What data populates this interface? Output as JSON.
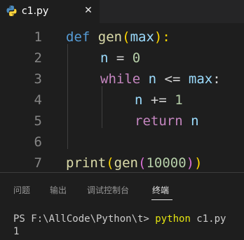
{
  "editor_tab": {
    "filename": "c1.py",
    "close_glyph": "✕",
    "icon": "python-icon"
  },
  "code_lines": [
    {
      "number": "1",
      "tokens": [
        {
          "text": "def",
          "kind": "keyword"
        },
        {
          "text": " ",
          "kind": "plain"
        },
        {
          "text": "gen",
          "kind": "function"
        },
        {
          "text": "(",
          "kind": "paren"
        },
        {
          "text": "max",
          "kind": "variable"
        },
        {
          "text": "):",
          "kind": "paren"
        }
      ]
    },
    {
      "number": "2",
      "tokens": [
        {
          "text": "n",
          "kind": "variable"
        },
        {
          "text": " = ",
          "kind": "plain"
        },
        {
          "text": "0",
          "kind": "number"
        }
      ]
    },
    {
      "number": "3",
      "tokens": [
        {
          "text": "while",
          "kind": "control"
        },
        {
          "text": " ",
          "kind": "plain"
        },
        {
          "text": "n",
          "kind": "variable"
        },
        {
          "text": " <= ",
          "kind": "plain"
        },
        {
          "text": "max",
          "kind": "variable"
        },
        {
          "text": ":",
          "kind": "plain"
        }
      ]
    },
    {
      "number": "4",
      "tokens": [
        {
          "text": "n",
          "kind": "variable"
        },
        {
          "text": " += ",
          "kind": "plain"
        },
        {
          "text": "1",
          "kind": "number"
        }
      ]
    },
    {
      "number": "5",
      "tokens": [
        {
          "text": "return",
          "kind": "control"
        },
        {
          "text": " ",
          "kind": "plain"
        },
        {
          "text": "n",
          "kind": "variable"
        }
      ]
    },
    {
      "number": "6",
      "tokens": []
    },
    {
      "number": "7",
      "tokens": [
        {
          "text": "print",
          "kind": "function"
        },
        {
          "text": "(",
          "kind": "paren"
        },
        {
          "text": "gen",
          "kind": "function"
        },
        {
          "text": "(",
          "kind": "paren2"
        },
        {
          "text": "10000",
          "kind": "number"
        },
        {
          "text": ")",
          "kind": "paren2"
        },
        {
          "text": ")",
          "kind": "paren"
        }
      ]
    }
  ],
  "panel": {
    "tabs": [
      "问题",
      "输出",
      "调试控制台",
      "终端"
    ],
    "active_tab": "终端"
  },
  "terminal": {
    "prompt": "PS F:\\AllCode\\Python\\t> ",
    "command": "python",
    "args": " c1.py",
    "output": "1"
  },
  "colors": {
    "keyword": "#569cd6",
    "control": "#c586c0",
    "function": "#dcdcaa",
    "variable": "#9cdcfe",
    "number": "#b5cea8",
    "plain": "#d4d4d4",
    "paren": "#ffd700",
    "paren2": "#da70d6",
    "terminal_command": "#e5e510"
  }
}
